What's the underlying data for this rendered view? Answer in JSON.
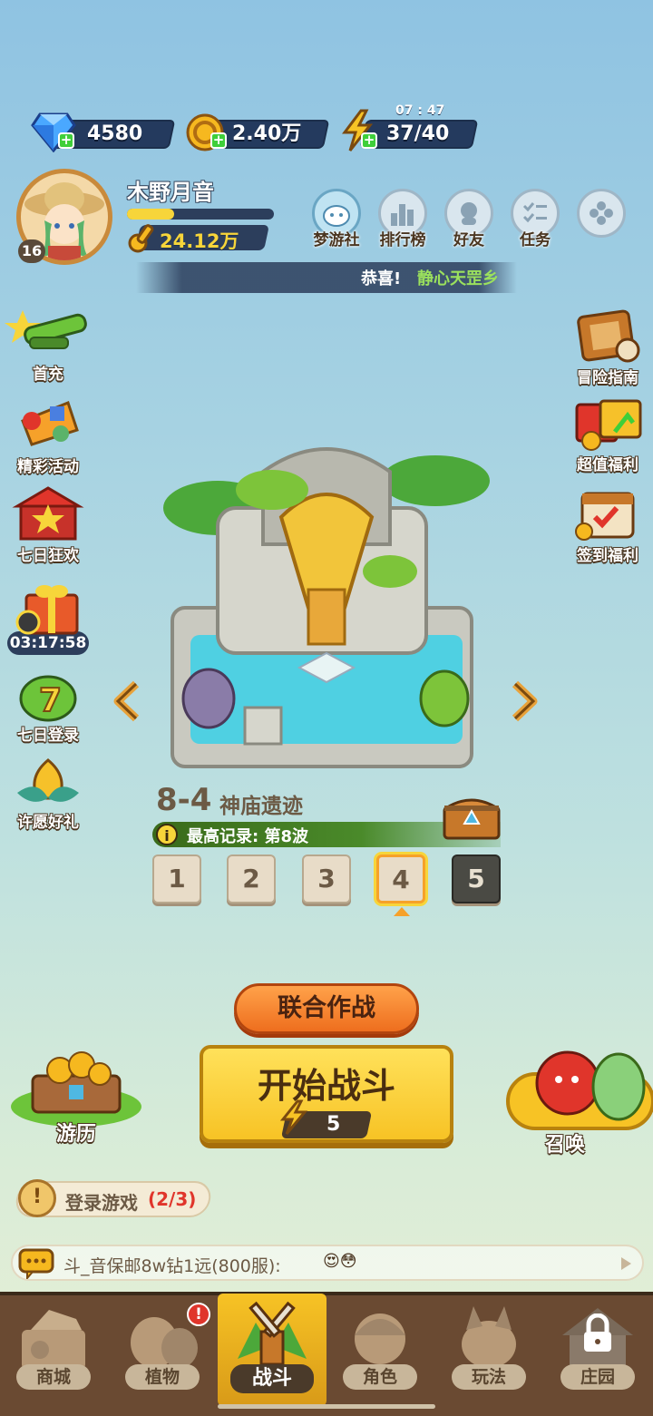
{
  "resources": {
    "diamond": "4580",
    "gold": "2.40万",
    "energy": "37/40",
    "energy_timer": "07 : 47"
  },
  "player": {
    "name": "木野月音",
    "level": "16",
    "power": "24.12万",
    "exp_fraction": 0.32
  },
  "top_menu": [
    {
      "label": "梦游社",
      "icon": "dream-club-icon"
    },
    {
      "label": "排行榜",
      "icon": "ranking-icon"
    },
    {
      "label": "好友",
      "icon": "friends-icon"
    },
    {
      "label": "任务",
      "icon": "task-icon"
    },
    {
      "label": "",
      "icon": "more-icon"
    }
  ],
  "marquee": {
    "prefix": "恭喜!",
    "highlight": "静心天罡乡"
  },
  "left_side": [
    {
      "label": "首充",
      "icon": "first-recharge-icon"
    },
    {
      "label": "精彩活动",
      "icon": "events-icon"
    },
    {
      "label": "七日狂欢",
      "icon": "seven-day-carnival-icon"
    },
    {
      "label": "03:17:58",
      "icon": "gift-icon"
    },
    {
      "label": "七日登录",
      "icon": "seven-day-login-icon"
    },
    {
      "label": "许愿好礼",
      "icon": "wish-gift-icon"
    }
  ],
  "right_side": [
    {
      "label": "冒险指南",
      "icon": "adventure-guide-icon"
    },
    {
      "label": "超值福利",
      "icon": "value-welfare-icon"
    },
    {
      "label": "签到福利",
      "icon": "checkin-welfare-icon"
    }
  ],
  "stage": {
    "title": "8-4",
    "name": "神庙遗迹",
    "record": "最高记录: 第8波",
    "levels": [
      "1",
      "2",
      "3",
      "4",
      "5"
    ],
    "selected_index": 3
  },
  "actions": {
    "coop_label": "联合作战",
    "start_label": "开始战斗",
    "start_cost": "5",
    "travel_label": "游历",
    "summon_label": "召唤"
  },
  "quest": {
    "label": "登录游戏",
    "progress": "(2/3)"
  },
  "chat": {
    "text": "斗_音保邮8w钻1远(800服):",
    "emoji": "😍😳"
  },
  "bottom_nav": [
    {
      "label": "商城",
      "icon": "shop-icon"
    },
    {
      "label": "植物",
      "icon": "plants-icon"
    },
    {
      "label": "战斗",
      "icon": "battle-icon"
    },
    {
      "label": "角色",
      "icon": "character-icon"
    },
    {
      "label": "玩法",
      "icon": "gameplay-icon"
    },
    {
      "label": "庄园",
      "icon": "manor-icon"
    }
  ],
  "colors": {
    "energy_yellow": "#f7c325",
    "button_orange": "#f28a2a",
    "green_text": "#3b8a1c",
    "red_progress": "#e0352b"
  }
}
